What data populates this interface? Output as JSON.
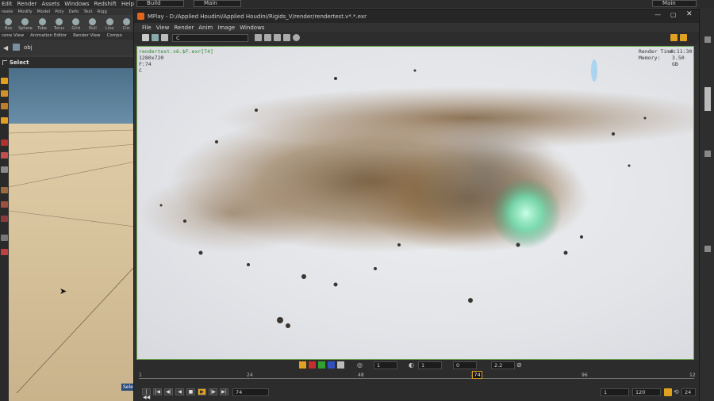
{
  "main_menu": [
    "Edit",
    "Render",
    "Assets",
    "Windows",
    "Redshift",
    "Help"
  ],
  "desktop_build": "Build",
  "desktop_main": "Main",
  "desktop_main_right": "Main",
  "shelf_tabs": [
    "reate",
    "Modify",
    "Model",
    "Poly",
    "Defo",
    "Text",
    "Rigg"
  ],
  "shelf_tools": [
    "Box",
    "Sphere",
    "Tube",
    "Torus",
    "Grid",
    "Null",
    "Line",
    "Circ"
  ],
  "pane_tabs": [
    "cene View",
    "Animation Editor",
    "Render View",
    "Compo"
  ],
  "path": "obj",
  "select_label": "Select",
  "viewport_badge": "Sele",
  "mplay": {
    "title": "MPlay - D:/Applied Houdini/Applied Houdini/Rigids_V/render/rendertest.v*.*.exr",
    "menu": [
      "File",
      "View",
      "Render",
      "Anim",
      "Image",
      "Windows"
    ],
    "channel": "C",
    "overlay_filename": "rendertest.v6.$F.exr[74]",
    "overlay_res": "1280x720",
    "overlay_frame": "F:74",
    "overlay_channel": "C",
    "render_time_label": "Render Time:",
    "render_time": "0:11:30",
    "memory_label": "Memory:",
    "memory": "3.50 GB"
  },
  "playbar": {
    "gamma_field": "1",
    "exposure_field": "1",
    "offset_field": "0",
    "gamma": "2.2",
    "ticks": [
      "1",
      "24",
      "48",
      "74",
      "96",
      "12"
    ],
    "current_frame_marker": "74",
    "current_frame": "74",
    "start_frame": "1",
    "end_frame": "120",
    "fps": "24",
    "transport_icons": [
      "|◀◀",
      "|◀",
      "◀|",
      "◀",
      "■",
      "▶",
      "|▶",
      "▶|"
    ]
  },
  "colors": {
    "accent_orange": "#e0a020",
    "border_green": "#6aa84f",
    "overlay_green": "#2f8a2f"
  }
}
